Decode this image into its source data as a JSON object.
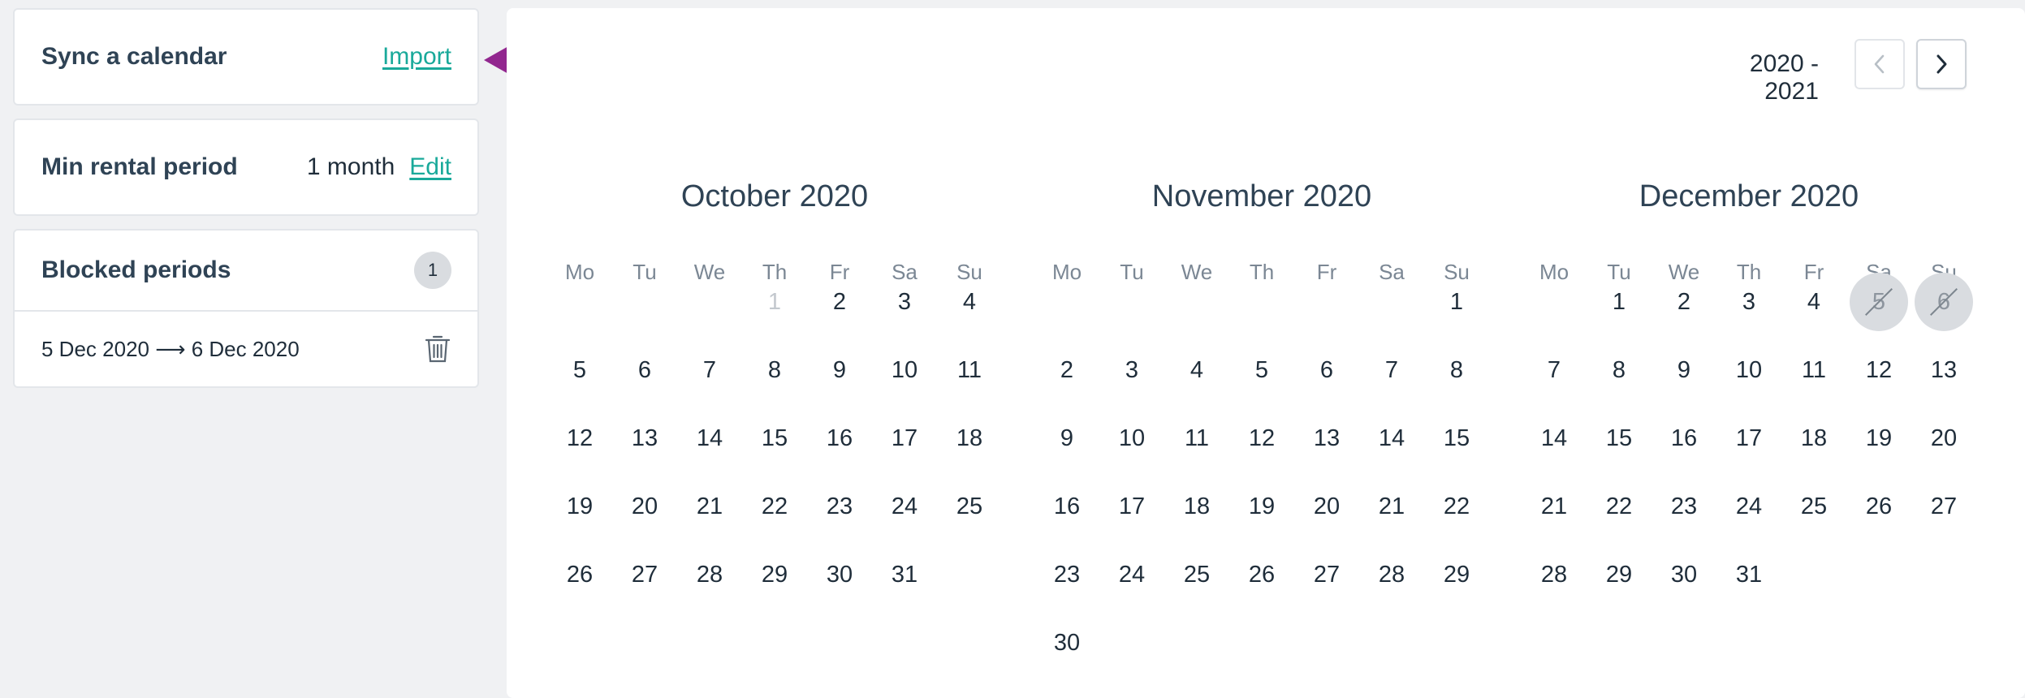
{
  "sidebar": {
    "sync": {
      "title": "Sync a calendar",
      "action": "Import"
    },
    "min_rental": {
      "title": "Min rental period",
      "value": "1 month",
      "action": "Edit"
    },
    "blocked": {
      "title": "Blocked periods",
      "count": "1",
      "periods": [
        {
          "label": "5 Dec 2020 ⟶ 6 Dec 2020"
        }
      ]
    }
  },
  "annotation": {
    "arrow_color": "#92278f"
  },
  "calendar": {
    "range_label": "2020 - 2021",
    "prev_icon": "chevron-left-icon",
    "next_icon": "chevron-right-icon",
    "weekdays": [
      "Mo",
      "Tu",
      "We",
      "Th",
      "Fr",
      "Sa",
      "Su"
    ],
    "months": [
      {
        "title": "October 2020",
        "first_weekday": 3,
        "days": 31,
        "past_days": [
          1
        ],
        "blocked_days": []
      },
      {
        "title": "November 2020",
        "first_weekday": 6,
        "days": 30,
        "past_days": [],
        "blocked_days": []
      },
      {
        "title": "December 2020",
        "first_weekday": 1,
        "days": 31,
        "past_days": [],
        "blocked_days": [
          5,
          6
        ]
      }
    ]
  },
  "colors": {
    "accent": "#19a99a",
    "text": "#1f2d3a",
    "muted": "#7b8794",
    "blocked_bg": "#d9dce0",
    "page_bg": "#f0f1f3"
  }
}
